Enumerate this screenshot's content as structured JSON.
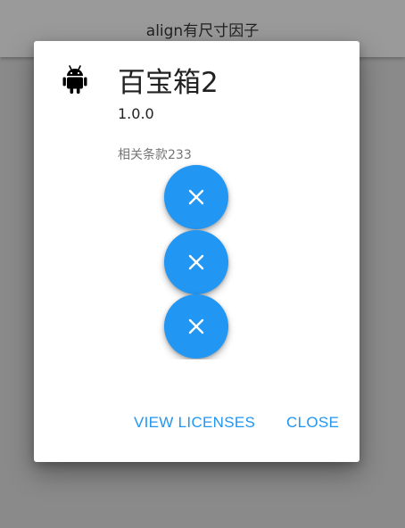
{
  "appbar": {
    "title": "align有尺寸因子"
  },
  "dialog": {
    "app_name": "百宝箱2",
    "app_version": "1.0.0",
    "legalese": "相关条款233",
    "icon": "android-icon",
    "fabs": [
      {
        "icon": "close-icon"
      },
      {
        "icon": "close-icon"
      },
      {
        "icon": "close-icon"
      }
    ],
    "actions": {
      "view_licenses": "VIEW LICENSES",
      "close": "CLOSE"
    }
  },
  "colors": {
    "accent": "#2196F3",
    "dialog_bg": "#FFFFFF",
    "scrim": "#8A8A8A"
  }
}
